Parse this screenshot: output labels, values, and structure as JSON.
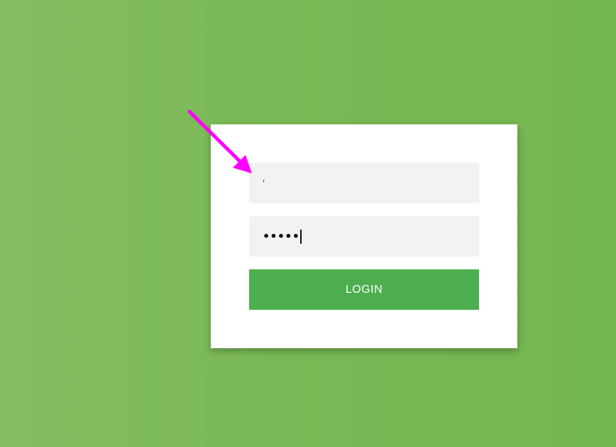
{
  "login_form": {
    "username_value": "'",
    "password_value": "•••••",
    "login_button_label": "LOGIN"
  },
  "colors": {
    "background": "#7ab955",
    "card": "#ffffff",
    "field_background": "#f2f2f2",
    "login_button": "#4cae4f",
    "annotation_arrow": "#ff00ff"
  },
  "icons": {
    "annotation": "arrow-icon"
  }
}
